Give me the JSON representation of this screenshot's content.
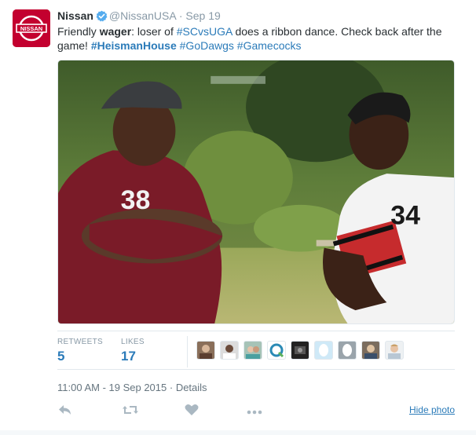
{
  "author": {
    "name": "Nissan",
    "handle": "@NissanUSA",
    "date": "Sep 19",
    "avatar_text": "NISSAN",
    "brand_color": "#c3002f"
  },
  "tweet_text": {
    "p1": "Friendly ",
    "p2": "wager",
    "p3": ": loser of ",
    "p4": "#SCvsUGA",
    "p5": " does a ribbon dance. Check back after the game! ",
    "p6": "#HeismanHouse",
    "p7": " ",
    "p8": "#GoDawgs",
    "p9": " ",
    "p10": "#Gamecocks"
  },
  "photo": {
    "jersey_left": "38",
    "jersey_right": "34"
  },
  "stats": {
    "retweets_label": "RETWEETS",
    "retweets_value": "5",
    "likes_label": "LIKES",
    "likes_value": "17"
  },
  "timestamp": {
    "time": "11:00 AM - 19 Sep 2015",
    "sep": " · ",
    "details": "Details"
  },
  "actions": {
    "reply_icon": "reply-icon",
    "retweet_icon": "retweet-icon",
    "like_icon": "heart-icon",
    "more_icon": "more-icon",
    "hide_photo": "Hide photo"
  },
  "colors": {
    "link": "#2b7bb9",
    "muted": "#8899a6",
    "verified": "#55acee"
  }
}
